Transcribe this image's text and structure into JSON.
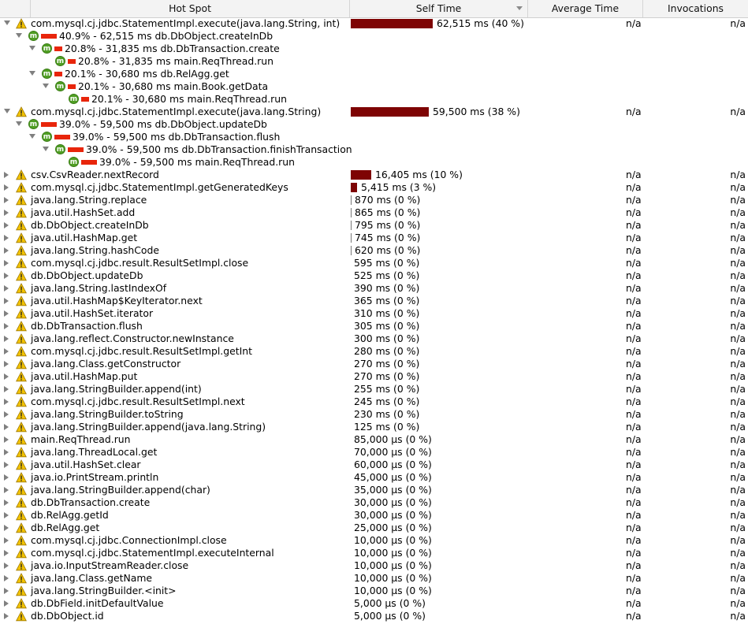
{
  "columns": {
    "hot_spot": "Hot Spot",
    "self_time": "Self Time",
    "average_time": "Average Time",
    "invocations": "Invocations"
  },
  "rows": [
    {
      "kind": "hotspot",
      "state": "expanded",
      "label": "com.mysql.cj.jdbc.StatementImpl.execute(java.lang.String, int)",
      "self": "62,515 ms (40 %)",
      "share": 0.4,
      "avg": "n/a",
      "inv": "n/a"
    },
    {
      "kind": "call",
      "depth": 1,
      "state": "expanded",
      "label": "40.9% - 62,515 ms db.DbObject.createInDb",
      "share": 0.409
    },
    {
      "kind": "call",
      "depth": 2,
      "state": "expanded",
      "label": "20.8% - 31,835 ms db.DbTransaction.create",
      "share": 0.208
    },
    {
      "kind": "call",
      "depth": 3,
      "state": "leaf",
      "label": "20.8% - 31,835 ms main.ReqThread.run",
      "share": 0.208
    },
    {
      "kind": "call",
      "depth": 2,
      "state": "expanded",
      "label": "20.1% - 30,680 ms db.RelAgg.get",
      "share": 0.201
    },
    {
      "kind": "call",
      "depth": 3,
      "state": "expanded",
      "label": "20.1% - 30,680 ms main.Book.getData",
      "share": 0.201
    },
    {
      "kind": "call",
      "depth": 4,
      "state": "leaf",
      "label": "20.1% - 30,680 ms main.ReqThread.run",
      "share": 0.201
    },
    {
      "kind": "hotspot",
      "state": "expanded",
      "label": "com.mysql.cj.jdbc.StatementImpl.execute(java.lang.String)",
      "self": "59,500 ms (38 %)",
      "share": 0.38,
      "avg": "n/a",
      "inv": "n/a"
    },
    {
      "kind": "call",
      "depth": 1,
      "state": "expanded",
      "label": "39.0% - 59,500 ms db.DbObject.updateDb",
      "share": 0.39
    },
    {
      "kind": "call",
      "depth": 2,
      "state": "expanded",
      "label": "39.0% - 59,500 ms db.DbTransaction.flush",
      "share": 0.39
    },
    {
      "kind": "call",
      "depth": 3,
      "state": "expanded",
      "label": "39.0% - 59,500 ms db.DbTransaction.finishTransaction",
      "share": 0.39
    },
    {
      "kind": "call",
      "depth": 4,
      "state": "leaf",
      "label": "39.0% - 59,500 ms main.ReqThread.run",
      "share": 0.39
    },
    {
      "kind": "hotspot",
      "state": "collapsed",
      "label": "csv.CsvReader.nextRecord",
      "self": "16,405 ms (10 %)",
      "share": 0.1,
      "avg": "n/a",
      "inv": "n/a"
    },
    {
      "kind": "hotspot",
      "state": "collapsed",
      "label": "com.mysql.cj.jdbc.StatementImpl.getGeneratedKeys",
      "self": "5,415 ms (3 %)",
      "share": 0.03,
      "avg": "n/a",
      "inv": "n/a"
    },
    {
      "kind": "hotspot",
      "state": "collapsed",
      "label": "java.lang.String.replace",
      "self": "870 ms (0 %)",
      "share": 0.005,
      "avg": "n/a",
      "inv": "n/a"
    },
    {
      "kind": "hotspot",
      "state": "collapsed",
      "label": "java.util.HashSet.add",
      "self": "865 ms (0 %)",
      "share": 0.005,
      "avg": "n/a",
      "inv": "n/a"
    },
    {
      "kind": "hotspot",
      "state": "collapsed",
      "label": "db.DbObject.createInDb",
      "self": "795 ms (0 %)",
      "share": 0.005,
      "avg": "n/a",
      "inv": "n/a"
    },
    {
      "kind": "hotspot",
      "state": "collapsed",
      "label": "java.util.HashMap.get",
      "self": "745 ms (0 %)",
      "share": 0.005,
      "avg": "n/a",
      "inv": "n/a"
    },
    {
      "kind": "hotspot",
      "state": "collapsed",
      "label": "java.lang.String.hashCode",
      "self": "620 ms (0 %)",
      "share": 0.004,
      "avg": "n/a",
      "inv": "n/a"
    },
    {
      "kind": "hotspot",
      "state": "collapsed",
      "label": "com.mysql.cj.jdbc.result.ResultSetImpl.close",
      "self": "595 ms (0 %)",
      "share": 0,
      "avg": "n/a",
      "inv": "n/a"
    },
    {
      "kind": "hotspot",
      "state": "collapsed",
      "label": "db.DbObject.updateDb",
      "self": "525 ms (0 %)",
      "share": 0,
      "avg": "n/a",
      "inv": "n/a"
    },
    {
      "kind": "hotspot",
      "state": "collapsed",
      "label": "java.lang.String.lastIndexOf",
      "self": "390 ms (0 %)",
      "share": 0,
      "avg": "n/a",
      "inv": "n/a"
    },
    {
      "kind": "hotspot",
      "state": "collapsed",
      "label": "java.util.HashMap$KeyIterator.next",
      "self": "365 ms (0 %)",
      "share": 0,
      "avg": "n/a",
      "inv": "n/a"
    },
    {
      "kind": "hotspot",
      "state": "collapsed",
      "label": "java.util.HashSet.iterator",
      "self": "310 ms (0 %)",
      "share": 0,
      "avg": "n/a",
      "inv": "n/a"
    },
    {
      "kind": "hotspot",
      "state": "collapsed",
      "label": "db.DbTransaction.flush",
      "self": "305 ms (0 %)",
      "share": 0,
      "avg": "n/a",
      "inv": "n/a"
    },
    {
      "kind": "hotspot",
      "state": "collapsed",
      "label": "java.lang.reflect.Constructor.newInstance",
      "self": "300 ms (0 %)",
      "share": 0,
      "avg": "n/a",
      "inv": "n/a"
    },
    {
      "kind": "hotspot",
      "state": "collapsed",
      "label": "com.mysql.cj.jdbc.result.ResultSetImpl.getInt",
      "self": "280 ms (0 %)",
      "share": 0,
      "avg": "n/a",
      "inv": "n/a"
    },
    {
      "kind": "hotspot",
      "state": "collapsed",
      "label": "java.lang.Class.getConstructor",
      "self": "270 ms (0 %)",
      "share": 0,
      "avg": "n/a",
      "inv": "n/a"
    },
    {
      "kind": "hotspot",
      "state": "collapsed",
      "label": "java.util.HashMap.put",
      "self": "270 ms (0 %)",
      "share": 0,
      "avg": "n/a",
      "inv": "n/a"
    },
    {
      "kind": "hotspot",
      "state": "collapsed",
      "label": "java.lang.StringBuilder.append(int)",
      "self": "255 ms (0 %)",
      "share": 0,
      "avg": "n/a",
      "inv": "n/a"
    },
    {
      "kind": "hotspot",
      "state": "collapsed",
      "label": "com.mysql.cj.jdbc.result.ResultSetImpl.next",
      "self": "245 ms (0 %)",
      "share": 0,
      "avg": "n/a",
      "inv": "n/a"
    },
    {
      "kind": "hotspot",
      "state": "collapsed",
      "label": "java.lang.StringBuilder.toString",
      "self": "230 ms (0 %)",
      "share": 0,
      "avg": "n/a",
      "inv": "n/a"
    },
    {
      "kind": "hotspot",
      "state": "collapsed",
      "label": "java.lang.StringBuilder.append(java.lang.String)",
      "self": "125 ms (0 %)",
      "share": 0,
      "avg": "n/a",
      "inv": "n/a"
    },
    {
      "kind": "hotspot",
      "state": "collapsed",
      "label": "main.ReqThread.run",
      "self": "85,000 µs (0 %)",
      "share": 0,
      "avg": "n/a",
      "inv": "n/a"
    },
    {
      "kind": "hotspot",
      "state": "collapsed",
      "label": "java.lang.ThreadLocal.get",
      "self": "70,000 µs (0 %)",
      "share": 0,
      "avg": "n/a",
      "inv": "n/a"
    },
    {
      "kind": "hotspot",
      "state": "collapsed",
      "label": "java.util.HashSet.clear",
      "self": "60,000 µs (0 %)",
      "share": 0,
      "avg": "n/a",
      "inv": "n/a"
    },
    {
      "kind": "hotspot",
      "state": "collapsed",
      "label": "java.io.PrintStream.println",
      "self": "45,000 µs (0 %)",
      "share": 0,
      "avg": "n/a",
      "inv": "n/a"
    },
    {
      "kind": "hotspot",
      "state": "collapsed",
      "label": "java.lang.StringBuilder.append(char)",
      "self": "35,000 µs (0 %)",
      "share": 0,
      "avg": "n/a",
      "inv": "n/a"
    },
    {
      "kind": "hotspot",
      "state": "collapsed",
      "label": "db.DbTransaction.create",
      "self": "30,000 µs (0 %)",
      "share": 0,
      "avg": "n/a",
      "inv": "n/a"
    },
    {
      "kind": "hotspot",
      "state": "collapsed",
      "label": "db.RelAgg.getId",
      "self": "30,000 µs (0 %)",
      "share": 0,
      "avg": "n/a",
      "inv": "n/a"
    },
    {
      "kind": "hotspot",
      "state": "collapsed",
      "label": "db.RelAgg.get",
      "self": "25,000 µs (0 %)",
      "share": 0,
      "avg": "n/a",
      "inv": "n/a"
    },
    {
      "kind": "hotspot",
      "state": "collapsed",
      "label": "com.mysql.cj.jdbc.ConnectionImpl.close",
      "self": "10,000 µs (0 %)",
      "share": 0,
      "avg": "n/a",
      "inv": "n/a"
    },
    {
      "kind": "hotspot",
      "state": "collapsed",
      "label": "com.mysql.cj.jdbc.StatementImpl.executeInternal",
      "self": "10,000 µs (0 %)",
      "share": 0,
      "avg": "n/a",
      "inv": "n/a"
    },
    {
      "kind": "hotspot",
      "state": "collapsed",
      "label": "java.io.InputStreamReader.close",
      "self": "10,000 µs (0 %)",
      "share": 0,
      "avg": "n/a",
      "inv": "n/a"
    },
    {
      "kind": "hotspot",
      "state": "collapsed",
      "label": "java.lang.Class.getName",
      "self": "10,000 µs (0 %)",
      "share": 0,
      "avg": "n/a",
      "inv": "n/a"
    },
    {
      "kind": "hotspot",
      "state": "collapsed",
      "label": "java.lang.StringBuilder.<init>",
      "self": "10,000 µs (0 %)",
      "share": 0,
      "avg": "n/a",
      "inv": "n/a"
    },
    {
      "kind": "hotspot",
      "state": "collapsed",
      "label": "db.DbField.initDefaultValue",
      "self": "5,000 µs (0 %)",
      "share": 0,
      "avg": "n/a",
      "inv": "n/a"
    },
    {
      "kind": "hotspot",
      "state": "collapsed",
      "label": "db.DbObject.id",
      "self": "5,000 µs (0 %)",
      "share": 0,
      "avg": "n/a",
      "inv": "n/a"
    }
  ],
  "colors": {
    "self_bar": "#7e0404",
    "call_bar": "#e8250b",
    "method_icon": "#4f9e23",
    "warning_icon": "#f2c200"
  },
  "icons": {
    "hotspot": "warning-icon",
    "call": "method-icon",
    "sort": "sort-descending-icon"
  }
}
